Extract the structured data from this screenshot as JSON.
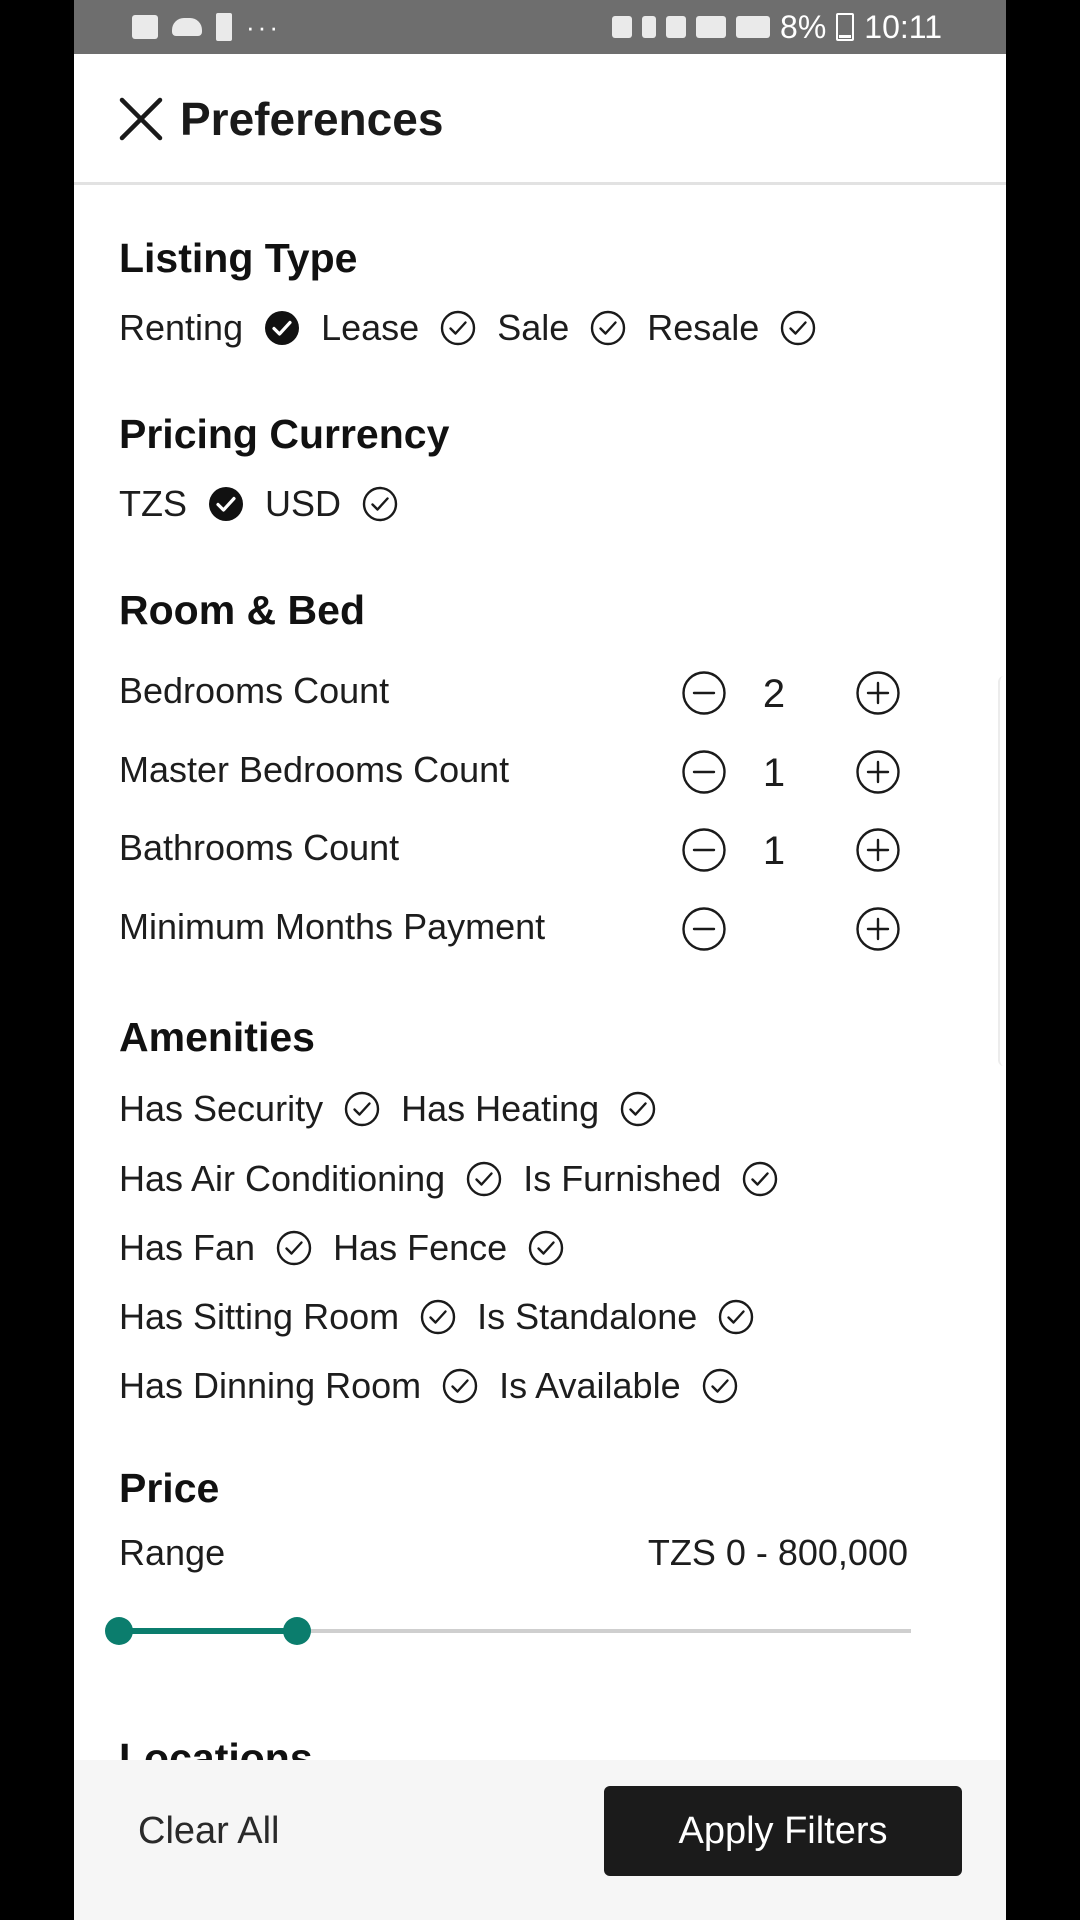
{
  "status_bar": {
    "battery": "8%",
    "time": "10:11",
    "left_icons": [
      "image-icon",
      "cloud-icon",
      "alert-icon",
      "more-dots-icon"
    ],
    "right_icons": [
      "nfc-icon",
      "bluetooth-icon",
      "mute-icon",
      "wifi-call-icon",
      "signal-icon",
      "battery-icon"
    ]
  },
  "header": {
    "title": "Preferences"
  },
  "listing_type": {
    "title": "Listing Type",
    "options": [
      {
        "label": "Renting",
        "checked": true
      },
      {
        "label": "Lease",
        "checked": false
      },
      {
        "label": "Sale",
        "checked": false
      },
      {
        "label": "Resale",
        "checked": false
      }
    ]
  },
  "pricing_currency": {
    "title": "Pricing Currency",
    "options": [
      {
        "label": "TZS",
        "checked": true
      },
      {
        "label": "USD",
        "checked": false
      }
    ]
  },
  "room_bed": {
    "title": "Room & Bed",
    "counters": [
      {
        "label": "Bedrooms Count",
        "value": "2"
      },
      {
        "label": "Master Bedrooms Count",
        "value": "1"
      },
      {
        "label": "Bathrooms Count",
        "value": "1"
      },
      {
        "label": "Minimum Months Payment",
        "value": ""
      }
    ]
  },
  "amenities": {
    "title": "Amenities",
    "rows": [
      [
        {
          "label": "Has Security",
          "checked": false
        },
        {
          "label": "Has Heating",
          "checked": false
        }
      ],
      [
        {
          "label": "Has Air Conditioning",
          "checked": false
        },
        {
          "label": "Is Furnished",
          "checked": false
        }
      ],
      [
        {
          "label": "Has Fan",
          "checked": false
        },
        {
          "label": "Has Fence",
          "checked": false
        }
      ],
      [
        {
          "label": "Has Sitting Room",
          "checked": false
        },
        {
          "label": "Is Standalone",
          "checked": false
        }
      ],
      [
        {
          "label": "Has Dinning Room",
          "checked": false
        },
        {
          "label": "Is Available",
          "checked": false
        }
      ]
    ]
  },
  "price": {
    "title": "Price",
    "range_label": "Range",
    "range_value": "TZS 0 - 800,000",
    "slider": {
      "low_fraction": 0.0,
      "high_fraction": 0.225
    },
    "accent_color": "#0b7d6d"
  },
  "next_section": {
    "title": "Locations"
  },
  "footer": {
    "clear_label": "Clear All",
    "apply_label": "Apply Filters"
  }
}
